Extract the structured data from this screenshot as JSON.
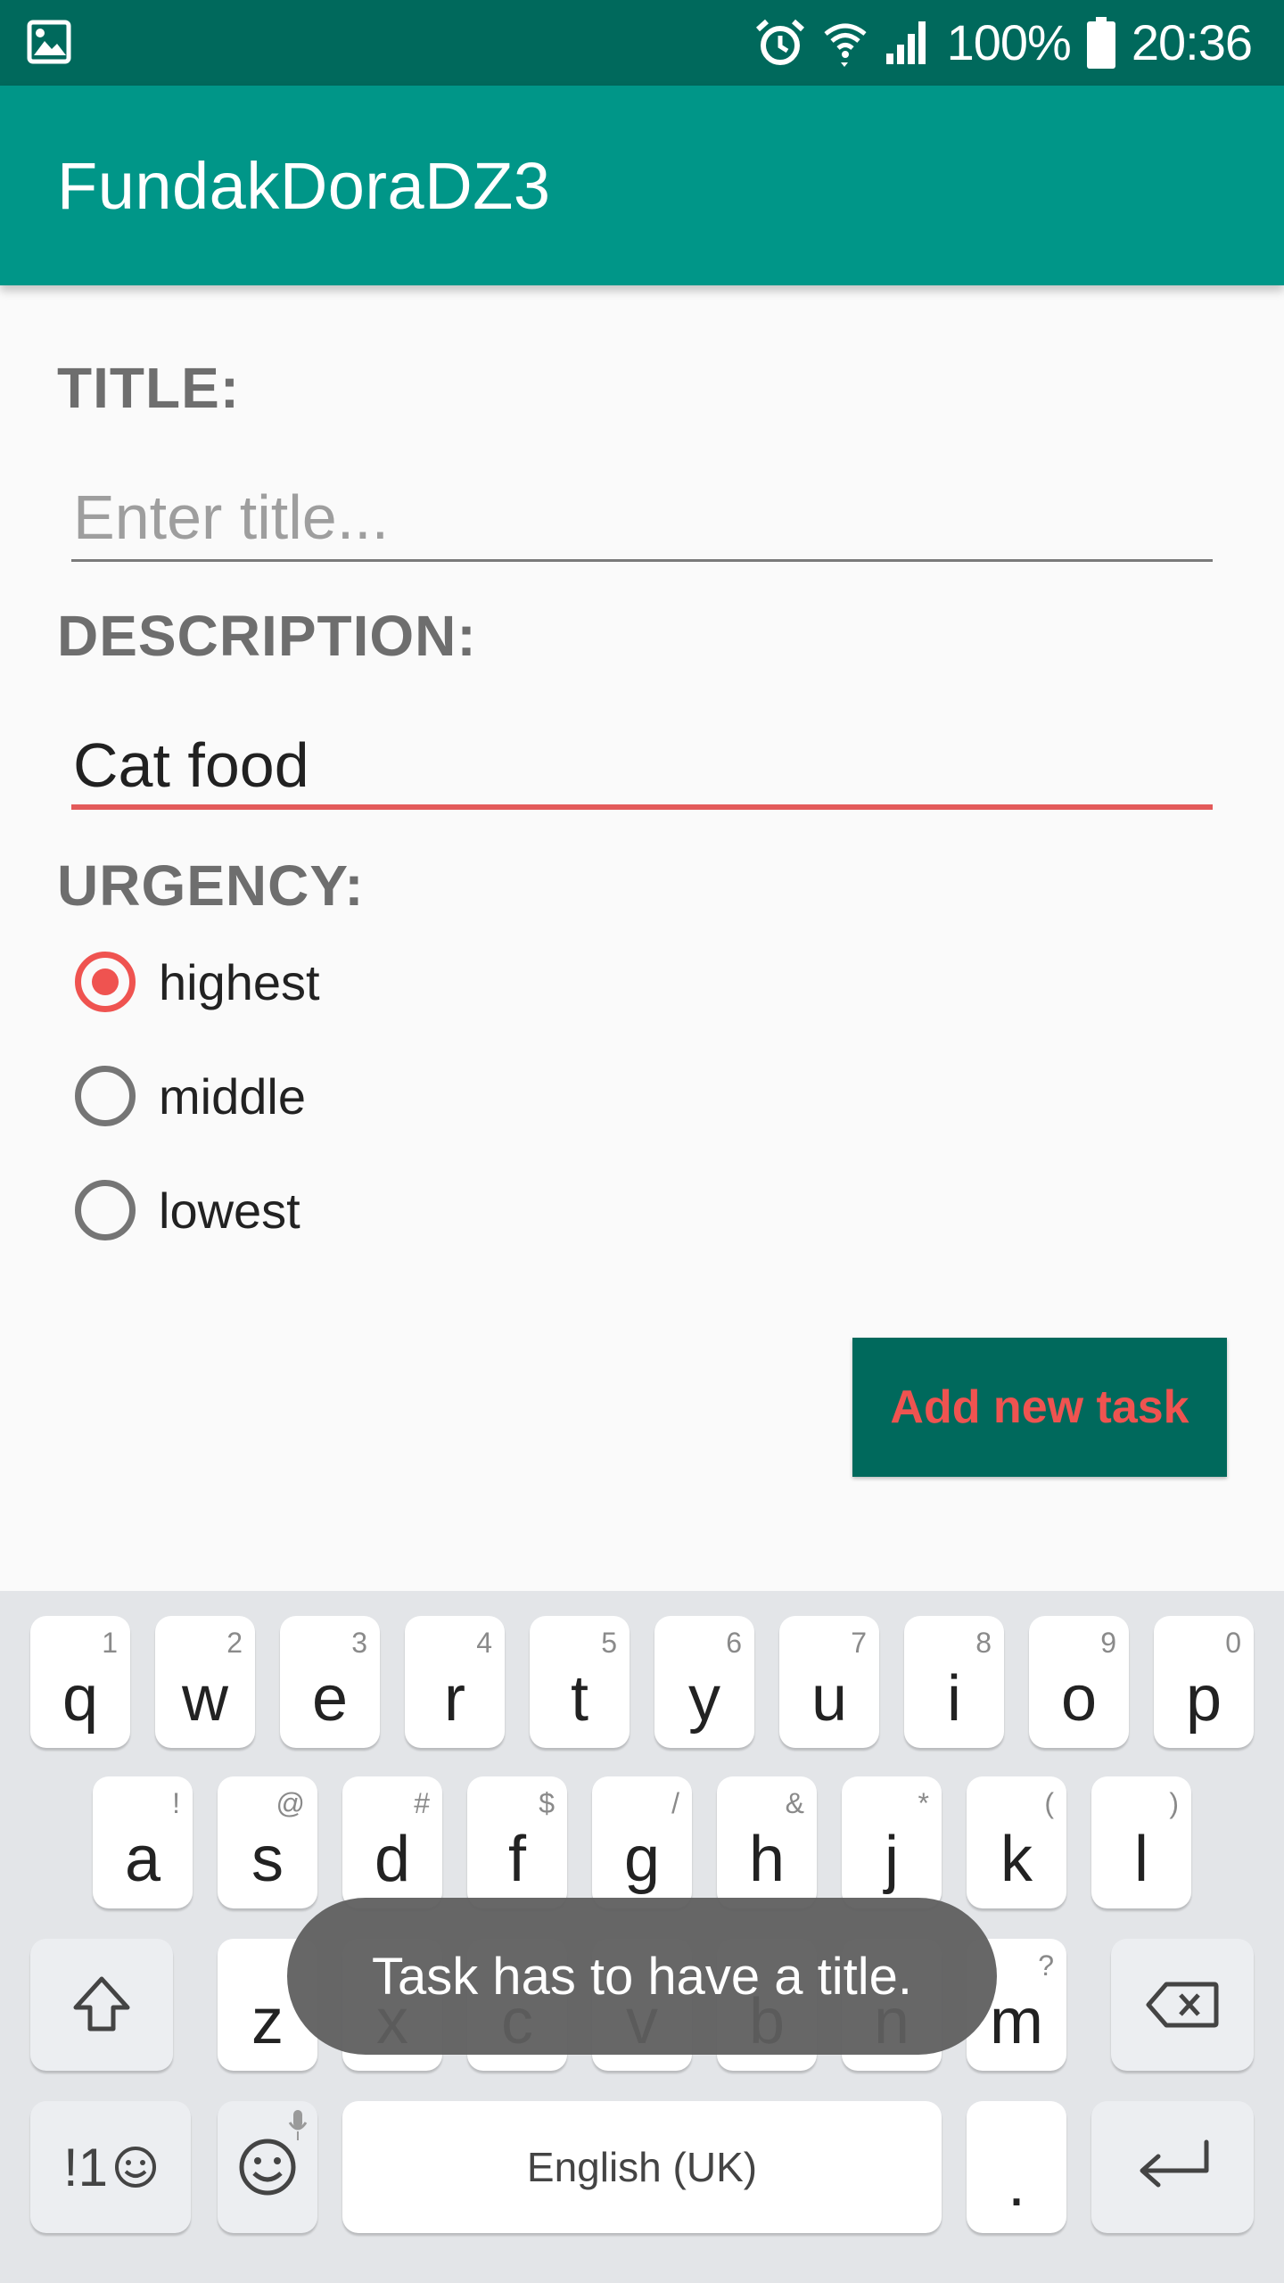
{
  "status_bar": {
    "battery": "100%",
    "time": "20:36"
  },
  "app_bar": {
    "title": "FundakDoraDZ3"
  },
  "form": {
    "title_label": "TITLE:",
    "title_placeholder": "Enter title...",
    "description_label": "DESCRIPTION:",
    "description_value": "Cat food",
    "urgency_label": "URGENCY:",
    "urgency_options": [
      {
        "label": "highest",
        "selected": true
      },
      {
        "label": "middle",
        "selected": false
      },
      {
        "label": "lowest",
        "selected": false
      }
    ],
    "add_button": "Add new task"
  },
  "keyboard": {
    "row1": [
      {
        "key": "q",
        "hint": "1"
      },
      {
        "key": "w",
        "hint": "2"
      },
      {
        "key": "e",
        "hint": "3"
      },
      {
        "key": "r",
        "hint": "4"
      },
      {
        "key": "t",
        "hint": "5"
      },
      {
        "key": "y",
        "hint": "6"
      },
      {
        "key": "u",
        "hint": "7"
      },
      {
        "key": "i",
        "hint": "8"
      },
      {
        "key": "o",
        "hint": "9"
      },
      {
        "key": "p",
        "hint": "0"
      }
    ],
    "row2": [
      {
        "key": "a",
        "hint": "!"
      },
      {
        "key": "s",
        "hint": "@"
      },
      {
        "key": "d",
        "hint": "#"
      },
      {
        "key": "f",
        "hint": "$"
      },
      {
        "key": "g",
        "hint": "/"
      },
      {
        "key": "h",
        "hint": "&"
      },
      {
        "key": "j",
        "hint": "*"
      },
      {
        "key": "k",
        "hint": "("
      },
      {
        "key": "l",
        "hint": ")"
      }
    ],
    "row3": [
      {
        "key": "z",
        "hint": ""
      },
      {
        "key": "x",
        "hint": ""
      },
      {
        "key": "c",
        "hint": ""
      },
      {
        "key": "v",
        "hint": ""
      },
      {
        "key": "b",
        "hint": ""
      },
      {
        "key": "n",
        "hint": ""
      },
      {
        "key": "m",
        "hint": "?"
      }
    ],
    "symbols_key": "!1",
    "space_label": "English (UK)",
    "period_key": "."
  },
  "toast": {
    "message": "Task has to have a title."
  },
  "colors": {
    "status_bar": "#00695c",
    "app_bar": "#009688",
    "accent": "#ef5350",
    "button_bg": "#00695c"
  }
}
